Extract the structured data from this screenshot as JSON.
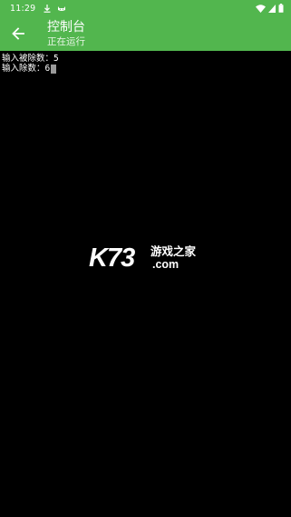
{
  "status_bar": {
    "time": "11:29",
    "icons": [
      "download-icon",
      "cat-icon",
      "wifi-icon",
      "signal-icon",
      "battery-icon"
    ]
  },
  "app_bar": {
    "back_icon": "arrow-left-icon",
    "title": "控制台",
    "subtitle": "正在运行",
    "color": "#52b64e"
  },
  "console": {
    "background": "#000000",
    "lines": [
      {
        "prompt": "输入被除数：",
        "value": "5"
      },
      {
        "prompt": "输入除数：",
        "value": "6"
      }
    ]
  },
  "watermark": {
    "logo": "K73",
    "text": "游戏之家",
    "domain": ".com"
  }
}
